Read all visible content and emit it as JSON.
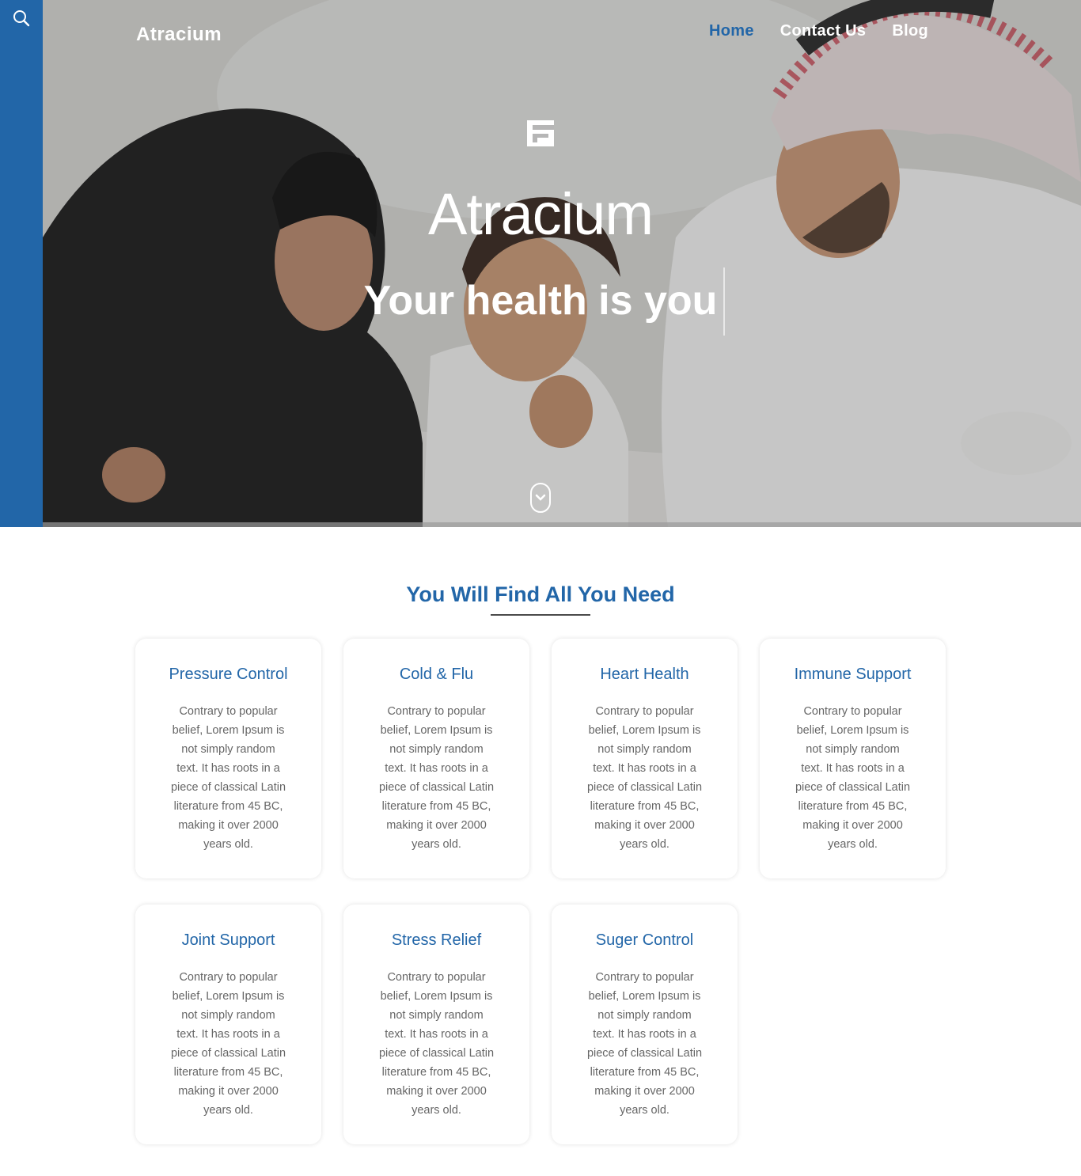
{
  "header": {
    "brand": "Atracium",
    "nav": [
      {
        "label": "Home",
        "active": true
      },
      {
        "label": "Contact Us",
        "active": false
      },
      {
        "label": "Blog",
        "active": false
      }
    ]
  },
  "hero": {
    "title": "Atracium",
    "subtitle": "Your health is you"
  },
  "services": {
    "heading": "You Will Find All You Need",
    "items": [
      {
        "title": "Pressure Control",
        "text": "Contrary to popular belief, Lorem Ipsum is not simply random text. It has roots in a piece of classical Latin literature from 45 BC, making it over 2000 years old."
      },
      {
        "title": "Cold & Flu",
        "text": "Contrary to popular belief, Lorem Ipsum is not simply random text. It has roots in a piece of classical Latin literature from 45 BC, making it over 2000 years old."
      },
      {
        "title": "Heart Health",
        "text": "Contrary to popular belief, Lorem Ipsum is not simply random text. It has roots in a piece of classical Latin literature from 45 BC, making it over 2000 years old."
      },
      {
        "title": "Immune Support",
        "text": "Contrary to popular belief, Lorem Ipsum is not simply random text. It has roots in a piece of classical Latin literature from 45 BC, making it over 2000 years old."
      },
      {
        "title": "Joint Support",
        "text": "Contrary to popular belief, Lorem Ipsum is not simply random text. It has roots in a piece of classical Latin literature from 45 BC, making it over 2000 years old."
      },
      {
        "title": "Stress Relief",
        "text": "Contrary to popular belief, Lorem Ipsum is not simply random text. It has roots in a piece of classical Latin literature from 45 BC, making it over 2000 years old."
      },
      {
        "title": "Suger Control",
        "text": "Contrary to popular belief, Lorem Ipsum is not simply random text. It has roots in a piece of classical Latin literature from 45 BC, making it over 2000 years old."
      }
    ]
  },
  "icons": {
    "rail": "search-icon",
    "hero_logo": "logo-icon",
    "scroll": "chevron-down-icon"
  },
  "colors": {
    "accent": "#2266a8",
    "text_muted": "#666666"
  }
}
